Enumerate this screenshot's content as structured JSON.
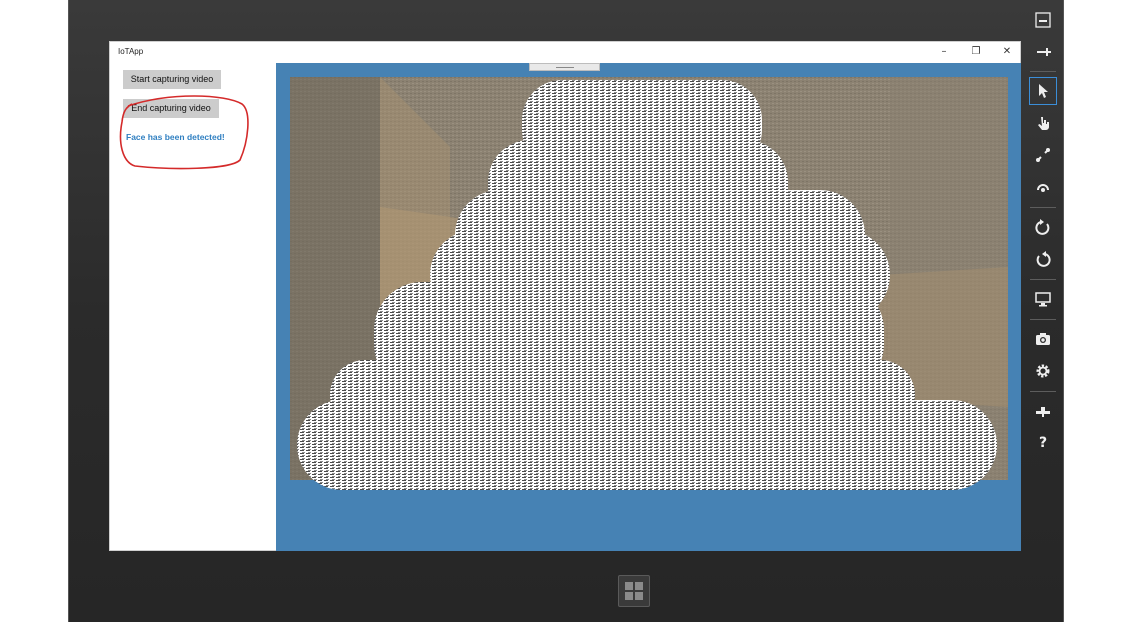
{
  "app": {
    "title": "IoTApp",
    "window_controls": {
      "minimize": "–",
      "restore": "❐",
      "close": "✕"
    }
  },
  "controls": {
    "start_label": "Start capturing video",
    "end_label": "End capturing video",
    "status_text": "Face has been detected!"
  },
  "colors": {
    "video_background": "#4682b4",
    "status_text": "#2f7fc1",
    "annotation": "#d42a2a",
    "button_bg": "#cccccc"
  },
  "simulator_toolbar": {
    "items": [
      {
        "icon": "minimize-icon"
      },
      {
        "icon": "pin-icon"
      },
      {
        "icon": "mouse-pointer-icon",
        "active": true
      },
      {
        "icon": "touch-hand-icon"
      },
      {
        "icon": "pinch-zoom-icon"
      },
      {
        "icon": "rotate-touch-icon"
      },
      {
        "icon": "rotate-clockwise-icon"
      },
      {
        "icon": "rotate-counterclockwise-icon"
      },
      {
        "icon": "resolution-monitor-icon"
      },
      {
        "icon": "camera-icon"
      },
      {
        "icon": "settings-gear-icon"
      },
      {
        "icon": "network-icon"
      },
      {
        "icon": "help-icon",
        "label": "?"
      }
    ]
  }
}
